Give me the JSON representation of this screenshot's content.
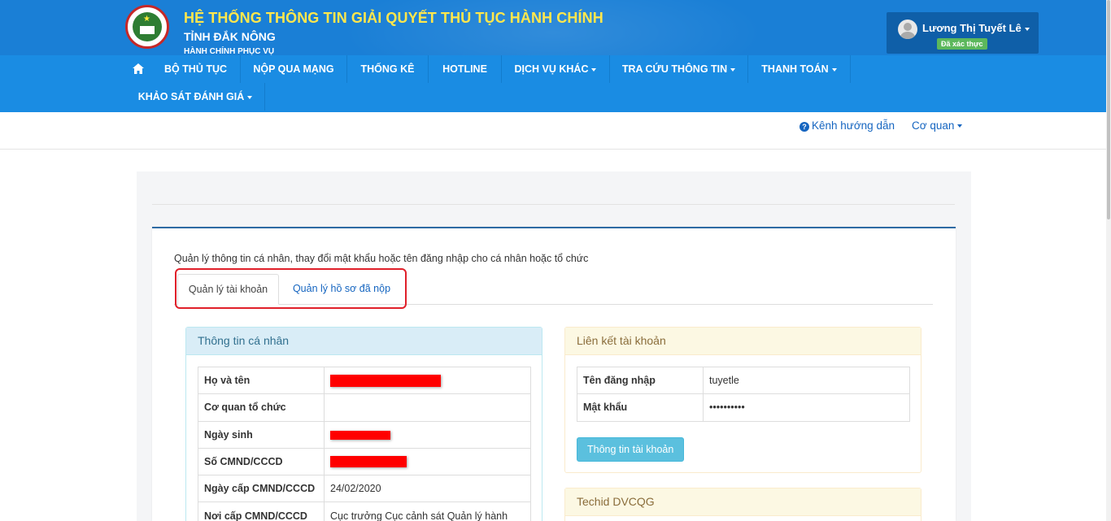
{
  "header": {
    "title": "HỆ THỐNG THÔNG TIN GIẢI QUYẾT THỦ TỤC HÀNH CHÍNH",
    "subtitle": "TỈNH ĐẮK NÔNG",
    "subtitle2": "HÀNH CHÍNH PHỤC VỤ",
    "user_name": "Lương Thị Tuyết Lê",
    "verified_badge": "Đã xác thực"
  },
  "nav": {
    "items": [
      {
        "label": "BỘ THỦ TỤC"
      },
      {
        "label": "NỘP QUA MẠNG"
      },
      {
        "label": "THỐNG KÊ"
      },
      {
        "label": "HOTLINE"
      },
      {
        "label": "DỊCH VỤ KHÁC"
      },
      {
        "label": "TRA CỨU THÔNG TIN"
      },
      {
        "label": "THANH TOÁN"
      },
      {
        "label": "KHẢO SÁT ĐÁNH GIÁ"
      }
    ]
  },
  "subbar": {
    "guide": "Kênh hướng dẫn",
    "agency": "Cơ quan"
  },
  "main": {
    "description": "Quản lý thông tin cá nhân, thay đổi mật khẩu hoặc tên đăng nhập cho cá nhân hoặc tổ chức",
    "tabs": [
      {
        "label": "Quản lý tài khoản"
      },
      {
        "label": "Quản lý hồ sơ đã nộp"
      }
    ]
  },
  "personal": {
    "heading": "Thông tin cá nhân",
    "rows": [
      {
        "label": "Họ và tên",
        "value": ""
      },
      {
        "label": "Cơ quan tổ chức",
        "value": ""
      },
      {
        "label": "Ngày sinh",
        "value": ""
      },
      {
        "label": "Số CMND/CCCD",
        "value": ""
      },
      {
        "label": "Ngày cấp CMND/CCCD",
        "value": "24/02/2020"
      },
      {
        "label": "Nơi cấp CMND/CCCD",
        "value": "Cục trưởng Cục cảnh sát Quản lý hành"
      }
    ]
  },
  "account": {
    "heading": "Liên kết tài khoản",
    "rows": [
      {
        "label": "Tên đăng nhập",
        "value": "tuyetle"
      },
      {
        "label": "Mật khẩu",
        "value": "••••••••••"
      }
    ],
    "button": "Thông tin tài khoản"
  },
  "techid": {
    "heading": "Techid DVCQG"
  },
  "colors": {
    "header_bg": "#1a7fd6",
    "nav_bg": "#1a8ce3",
    "title_yellow": "#ffe74c",
    "highlight_red": "#e0202a"
  }
}
